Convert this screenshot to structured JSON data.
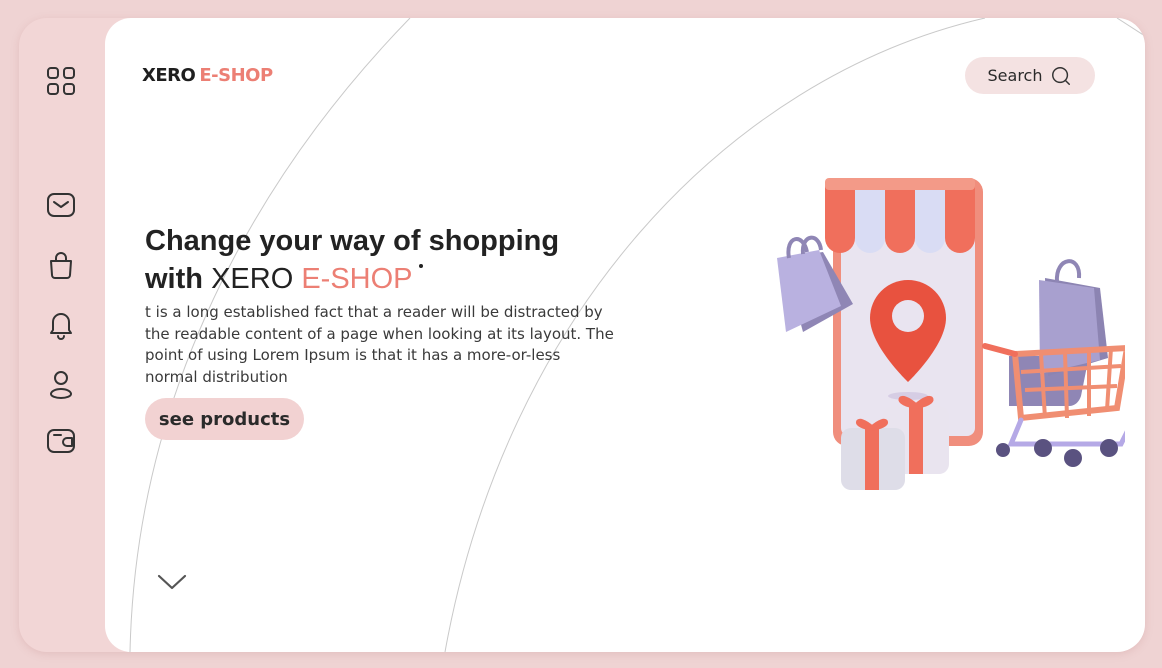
{
  "sidebar": {
    "items": [
      {
        "icon": "grid-icon"
      },
      {
        "icon": "mail-icon"
      },
      {
        "icon": "bag-icon"
      },
      {
        "icon": "bell-icon"
      },
      {
        "icon": "user-icon"
      },
      {
        "icon": "wallet-icon"
      }
    ]
  },
  "header": {
    "brand_part1": "XERO",
    "brand_part2": "E-SHOP",
    "search_label": "Search"
  },
  "hero": {
    "title_line1": "Change your way of shopping",
    "title_with": "with",
    "title_brand": "XERO",
    "title_accent": "E-SHOP",
    "body": "t is a long established fact that a reader will be distracted by the readable content of a page when looking at its layout. The point of using Lorem Ipsum is that it has a more-or-less normal distribution",
    "cta_label": "see products"
  },
  "colors": {
    "accent": "#ec7f74",
    "sidebar_bg": "#f2d6d6",
    "button_bg": "#f2d2d2",
    "page_bg": "#efd3d3"
  }
}
